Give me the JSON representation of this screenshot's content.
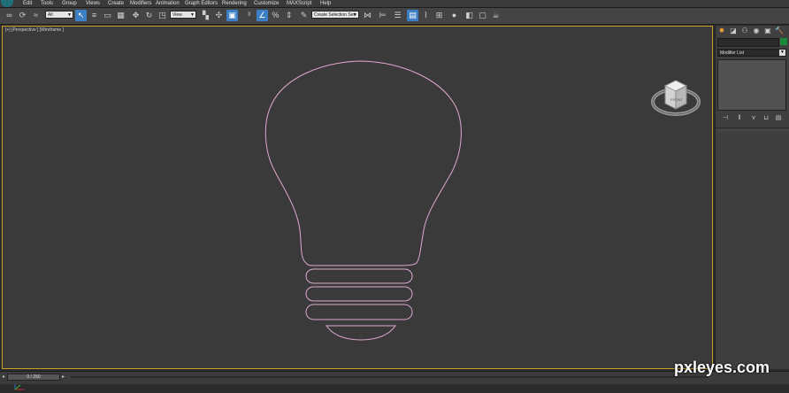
{
  "menu": {
    "items": [
      "Edit",
      "Tools",
      "Group",
      "Views",
      "Create",
      "Modifiers",
      "Animation",
      "Graph Editors",
      "Rendering",
      "Customize",
      "MAXScript",
      "Help"
    ]
  },
  "toolbar": {
    "selection_filter": "All",
    "reference_coord": "View",
    "named_selection_placeholder": "Create Selection Set"
  },
  "viewport": {
    "label": "[+] [Perspective ] [Wireframe ]",
    "object_color": "#e0a8d0"
  },
  "viewcube": {
    "face_label": "FRONT"
  },
  "command_panel": {
    "modifier_list_label": "Modifier List",
    "object_color": "#1a8a3a"
  },
  "timeline": {
    "frame_label": "0 / 250"
  },
  "watermark": {
    "text": "pxleyes.com"
  }
}
